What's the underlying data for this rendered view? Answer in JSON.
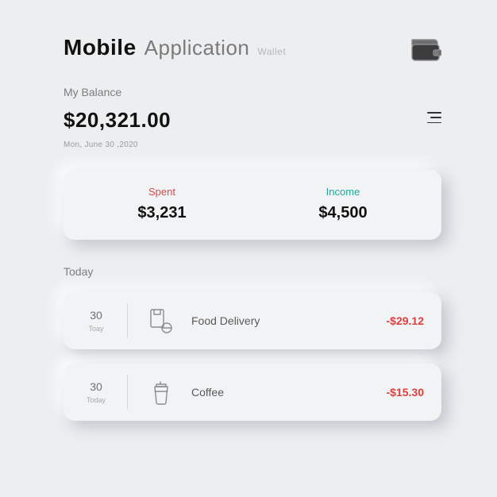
{
  "header": {
    "title_bold": "Mobile",
    "title_light": "Application",
    "title_tag": "Wallet"
  },
  "balance": {
    "label": "My Balance",
    "amount": "$20,321.00",
    "date": "Mon, June 30 ,2020"
  },
  "summary": {
    "spent_label": "Spent",
    "spent_value": "$3,231",
    "income_label": "Income",
    "income_value": "$4,500"
  },
  "section": {
    "today": "Today"
  },
  "tx": [
    {
      "day": "30",
      "day_label": "Toay",
      "name": "Food Delivery",
      "amount": "-$29.12"
    },
    {
      "day": "30",
      "day_label": "Today",
      "name": "Coffee",
      "amount": "-$15.30"
    }
  ],
  "colors": {
    "spent": "#d34b4b",
    "income": "#1aa99a",
    "negative": "#e03d3d"
  }
}
